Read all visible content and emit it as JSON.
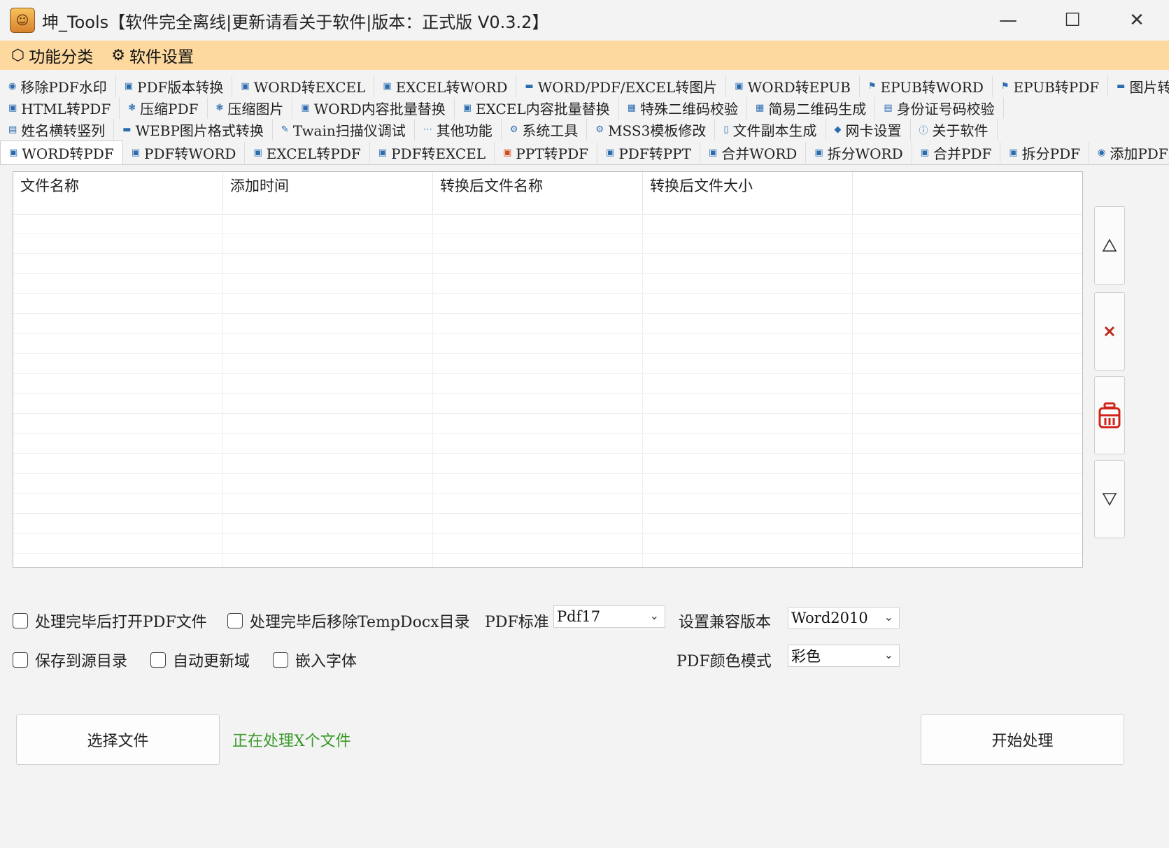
{
  "window": {
    "title": "坤_Tools【软件完全离线|更新请看关于软件|版本：正式版 V0.3.2】",
    "minimize": "—",
    "maximize": "☐",
    "close": "✕"
  },
  "menu": {
    "items": [
      {
        "label": "功能分类",
        "icon": "cube-icon"
      },
      {
        "label": "软件设置",
        "icon": "gear-icon"
      }
    ]
  },
  "tabs": {
    "rows": [
      [
        "移除PDF水印",
        "PDF版本转换",
        "WORD转EXCEL",
        "EXCEL转WORD",
        "WORD/PDF/EXCEL转图片",
        "WORD转EPUB",
        "EPUB转WORD",
        "EPUB转PDF",
        "图片转PDF"
      ],
      [
        "HTML转PDF",
        "压缩PDF",
        "压缩图片",
        "WORD内容批量替换",
        "EXCEL内容批量替换",
        "特殊二维码校验",
        "简易二维码生成",
        "身份证号码校验"
      ],
      [
        "姓名横转竖列",
        "WEBP图片格式转换",
        "Twain扫描仪调试",
        "其他功能",
        "系统工具",
        "MSS3模板修改",
        "文件副本生成",
        "网卡设置",
        "关于软件"
      ],
      [
        "WORD转PDF",
        "PDF转WORD",
        "EXCEL转PDF",
        "PDF转EXCEL",
        "PPT转PDF",
        "PDF转PPT",
        "合并WORD",
        "拆分WORD",
        "合并PDF",
        "拆分PDF",
        "添加PDF水印"
      ]
    ],
    "active": "WORD转PDF"
  },
  "table": {
    "columns": [
      "文件名称",
      "添加时间",
      "转换后文件名称",
      "转换后文件大小"
    ],
    "rows": []
  },
  "side_buttons": [
    {
      "name": "move-up-button",
      "icon": "triangle-up-icon"
    },
    {
      "name": "remove-button",
      "icon": "close-x-icon",
      "color": "#c0281e"
    },
    {
      "name": "clear-button",
      "icon": "trash-icon",
      "color": "#d0241a"
    },
    {
      "name": "move-down-button",
      "icon": "triangle-down-icon"
    }
  ],
  "options": {
    "open_pdf_after": "处理完毕后打开PDF文件",
    "remove_tempdocx": "处理完毕后移除TempDocx目录",
    "pdf_standard_label": "PDF标准",
    "pdf_standard_value": "Pdf17",
    "compat_label": "设置兼容版本",
    "compat_value": "Word2010",
    "save_to_source": "保存到源目录",
    "auto_update_fields": "自动更新域",
    "embed_fonts": "嵌入字体",
    "color_mode_label": "PDF颜色模式",
    "color_mode_value": "彩色"
  },
  "actions": {
    "select_files": "选择文件",
    "status": "正在处理X个文件",
    "start": "开始处理"
  },
  "colors": {
    "menubar": "#fdd9a0",
    "status_text": "#3a9a2a"
  }
}
